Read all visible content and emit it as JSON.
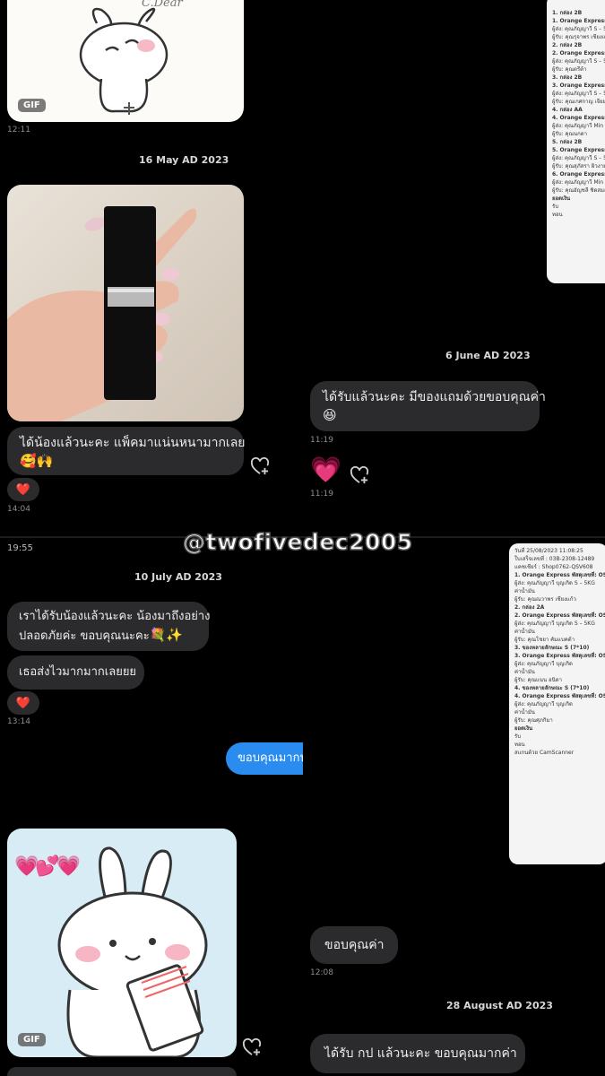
{
  "watermark": "@twofivedec2005",
  "top_left": {
    "sticker_time": "12:11",
    "sticker_label": "GIF",
    "sticker_caption": "C.Dear",
    "date": "16 May AD 2023",
    "message": "ได้น้องแล้วนะคะ แพ็คมาแน่นหนามากเลย",
    "message_emoji": "🥰🙌",
    "reaction": "❤️",
    "time": "14:04"
  },
  "top_right": {
    "receipt_lines": [
      "1. กล่อง 2B",
      "1. Orange Express เลขพัสดุ: OS",
      "ผู้ส่ง: คุณภัญญาวี   S – 5K",
      "ผู้รับ: คุณรุจาพร เชียงแก้ว",
      "2. กล่อง 2B",
      "2. Orange Express เลขพัสดุ: OS",
      "ผู้ส่ง: คุณภัญญาวี   S – 5K",
      "ผู้รับ: คุณตรีต้า",
      "3. กล่อง 2B",
      "3. Orange Express เลขพัสดุ: OS",
      "ผู้ส่ง: คุณภัญญาวี   S – 5K",
      "ผู้รับ: คุณเกศกาญ เจียมธา",
      "4. กล่อง AA",
      "4. Orange Express เลขพัสดุ: OS",
      "ผู้ส่ง: คุณภัญญาวี   Min",
      "ผู้รับ: คุณนกดา",
      "5. กล่อง 2B",
      "5. Orange Express เลขพัสดุ: OS",
      "ผู้ส่ง: คุณภัญญาวี   S – 5K",
      "ผู้รับ: คุณสุภัสรา ผิวงาม",
      "6. Orange Express เลขพัสดุ: OS",
      "ผู้ส่ง: คุณภัญญาวี   Min",
      "ผู้รับ: คุณอัญชลี ชิดสมอุล",
      "ยอดเงิน",
      "รับ",
      "ทอน"
    ],
    "date": "6 June AD 2023",
    "message": "ได้รับแล้วนะคะ มีของแถมด้วยขอบคุณค่า",
    "message_emoji": "😆",
    "time1": "11:19",
    "heart_emoji": "💗",
    "time2": "11:19"
  },
  "bottom_left": {
    "status_time": "19:55",
    "date": "10 July AD 2023",
    "message1_line1": "เราได้รับน้องแล้วนะคะ น้องมาถึงอย่าง",
    "message1_line2": "ปลอดภัยค่ะ ขอบคุณนะคะ",
    "message1_emoji": "💐✨",
    "message2": "เธอส่งไวมากมากเลยยย",
    "reaction": "❤️",
    "time": "13:14",
    "sent_message": "ขอบคุณมากน",
    "sticker_label": "GIF",
    "sticker_hearts": "💗💕💗"
  },
  "bottom_right": {
    "receipt_lines": [
      "วันที่ 25/08/2023 11:08:25",
      "ใบเสร็จเลขที่ : 03B-2308-12489",
      "แคชเชียร์ : Shop0762-QSV608",
      "1. Orange Express พัสดุเลขที่: OS",
      "ผู้ส่ง: คุณภัญญาวี บุญเกิด  S – 5KG",
      "ค่าน้ำมัน",
      "ผู้รับ: คุณณวาพร เชียงแก้ว",
      "2. กล่อง 2A",
      "2. Orange Express พัสดุเลขที่: OS",
      "ผู้ส่ง: คุณภัญญาวี บุญเกิด  S – 5KG",
      "ค่าน้ำมัน",
      "ผู้รับ: คุณโชยา คัมแบคด้า",
      "3. ของหลายลักษณะ S (7*10)",
      "3. Orange Express พัสดุเลขที่: OS",
      "ผู้ส่ง: คุณภัญญาวี บุญเกิด",
      "ค่าน้ำมัน",
      "ผู้รับ: คุณแนน อนิดา",
      "4. ของหลายลักษณะ S (7*10)",
      "4. Orange Express พัสดุเลขที่: OS",
      "ผู้ส่ง: คุณภัญญาวี บุญเกิด",
      "ค่าน้ำมัน",
      "ผู้รับ: คุณศุภกิมา",
      "ยอดเงิน",
      "รับ",
      "ทอน",
      "สแกนด้วย CamScanner"
    ],
    "message1": "ขอบคุณค่า",
    "time": "12:08",
    "date": "28 August AD 2023",
    "message2": "ได้รับ กป แล้วนะคะ ขอบคุณมากค่า"
  },
  "colors": {
    "background": "#000000",
    "bubble": "#2b2b2d",
    "sent_bubble": "#2b8cf0"
  }
}
